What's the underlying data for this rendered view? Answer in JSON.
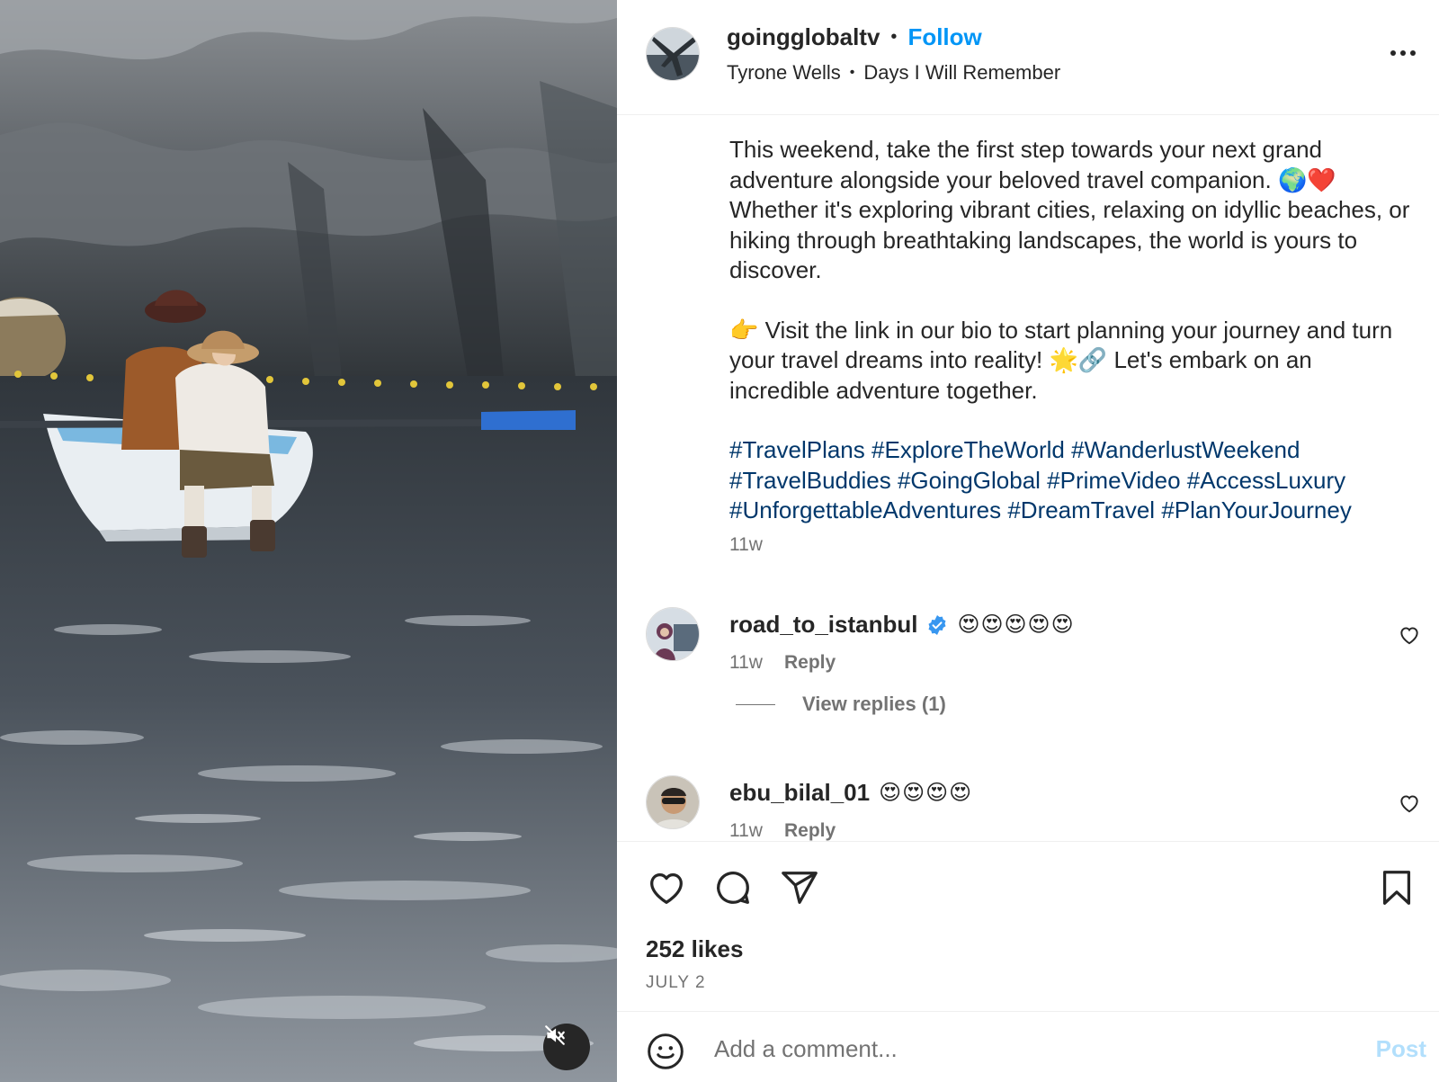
{
  "post": {
    "username": "goingglobaltv",
    "follow_label": "Follow",
    "separator": "•",
    "audio_artist": "Tyrone Wells",
    "audio_title": "Days I Will Remember",
    "caption_p1": "This weekend, take the first step towards your next grand adventure alongside your beloved travel companion. 🌍❤️ Whether it's exploring vibrant cities, relaxing on idyllic beaches, or hiking through breathtaking landscapes, the world is yours to discover.",
    "caption_p2": "👉 Visit the link in our bio to start planning your journey and turn your travel dreams into reality! 🌟🔗 Let's embark on an incredible adventure together.",
    "hashtags": [
      "#TravelPlans",
      "#ExploreTheWorld",
      "#WanderlustWeekend",
      "#TravelBuddies",
      "#GoingGlobal",
      "#PrimeVideo",
      "#AccessLuxury",
      "#UnforgettableAdventures",
      "#DreamTravel",
      "#PlanYourJourney"
    ],
    "age": "11w"
  },
  "comments": [
    {
      "username": "road_to_istanbul",
      "verified": true,
      "text": "😍😍😍😍😍",
      "age": "11w",
      "reply_label": "Reply",
      "view_replies_label": "View replies (1)"
    },
    {
      "username": "ebu_bilal_01",
      "verified": false,
      "text": "😍😍😍😍",
      "age": "11w",
      "reply_label": "Reply"
    }
  ],
  "engagement": {
    "likes_label": "252 likes",
    "date_label": "JULY 2"
  },
  "comment_box": {
    "placeholder": "Add a comment...",
    "post_label": "Post"
  },
  "icons": {
    "more": "more-options-icon",
    "like": "heart-icon",
    "comment": "comment-icon",
    "share": "send-icon",
    "save": "bookmark-icon",
    "emoji": "emoji-icon",
    "mute": "muted-speaker-icon",
    "verified": "verified-badge-icon"
  },
  "colors": {
    "accent": "#0095f6",
    "hashtag": "#00376b",
    "muted_text": "#737373",
    "post_button_disabled": "#b2dffc"
  }
}
